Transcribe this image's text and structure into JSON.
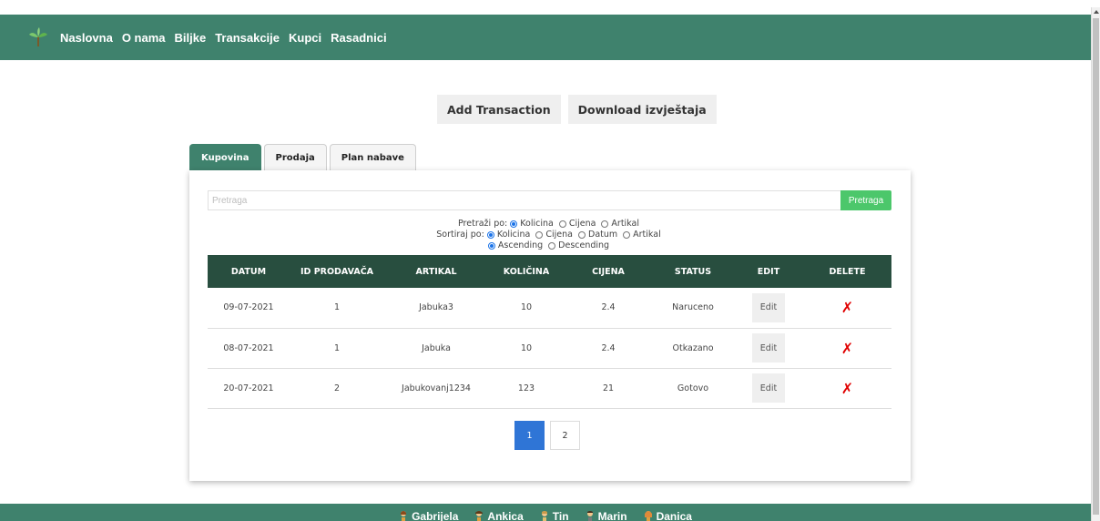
{
  "nav": {
    "logo_icon": "seedling-icon",
    "items": [
      "Naslovna",
      "O nama",
      "Biljke",
      "Transakcije",
      "Kupci",
      "Rasadnici"
    ]
  },
  "actions": {
    "add_transaction": "Add Transaction",
    "download_report": "Download izvještaja"
  },
  "tabs": [
    {
      "label": "Kupovina",
      "active": true
    },
    {
      "label": "Prodaja",
      "active": false
    },
    {
      "label": "Plan nabave",
      "active": false
    }
  ],
  "search": {
    "placeholder": "Pretraga",
    "button_label": "Pretraga"
  },
  "filters": {
    "search_by_label": "Pretraži po:",
    "search_by_options": [
      {
        "label": "Kolicina",
        "checked": true
      },
      {
        "label": "Cijena",
        "checked": false
      },
      {
        "label": "Artikal",
        "checked": false
      }
    ],
    "sort_by_label": "Sortiraj po:",
    "sort_by_options": [
      {
        "label": "Kolicina",
        "checked": true
      },
      {
        "label": "Cijena",
        "checked": false
      },
      {
        "label": "Datum",
        "checked": false
      },
      {
        "label": "Artikal",
        "checked": false
      }
    ],
    "order_options": [
      {
        "label": "Ascending",
        "checked": true
      },
      {
        "label": "Descending",
        "checked": false
      }
    ]
  },
  "table": {
    "headers": [
      "DATUM",
      "ID PRODAVAČA",
      "ARTIKAL",
      "KOLIČINA",
      "CIJENA",
      "STATUS",
      "EDIT",
      "DELETE"
    ],
    "edit_label": "Edit",
    "delete_glyph": "✗",
    "rows": [
      {
        "datum": "09-07-2021",
        "id": "1",
        "artikal": "Jabuka3",
        "kolicina": "10",
        "cijena": "2.4",
        "status": "Naruceno",
        "status_color": "#1c2fd1"
      },
      {
        "datum": "08-07-2021",
        "id": "1",
        "artikal": "Jabuka",
        "kolicina": "10",
        "cijena": "2.4",
        "status": "Otkazano",
        "status_color": "#e01010"
      },
      {
        "datum": "20-07-2021",
        "id": "2",
        "artikal": "Jabukovanj1234",
        "kolicina": "123",
        "cijena": "21",
        "status": "Gotovo",
        "status_color": "#2e7d32"
      }
    ]
  },
  "pagination": {
    "pages": [
      "1",
      "2"
    ],
    "current": "1"
  },
  "footer": {
    "members": [
      "Gabrijela",
      "Ankica",
      "Tin",
      "Marin",
      "Danica"
    ]
  },
  "colors": {
    "brand": "#3f826d",
    "table_header": "#284e3f",
    "search_button": "#4cc76b",
    "page_active": "#2f75d6",
    "delete": "#e00000"
  }
}
